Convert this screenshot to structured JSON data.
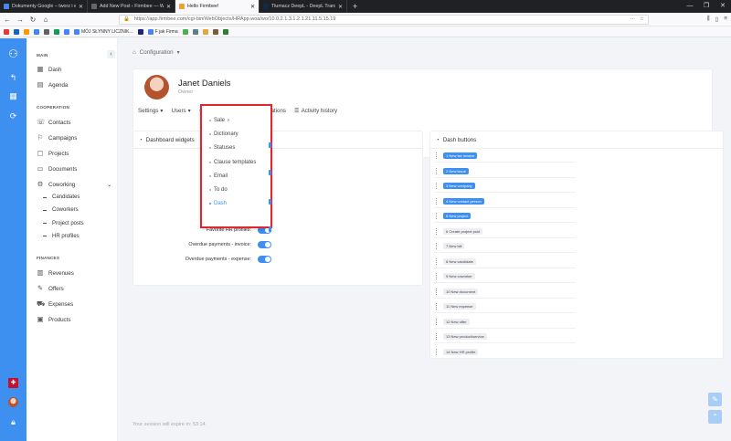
{
  "browser": {
    "tabs": [
      {
        "title": "Dokumenty Google – tworz i e",
        "active": false,
        "color": "#4a86e8"
      },
      {
        "title": "Add New Post ‹ Firmbee — WordPr",
        "active": false,
        "color": "#666666"
      },
      {
        "title": "Hello Firmbee!",
        "active": true,
        "color": "#e8a33d"
      },
      {
        "title": "Tłumacz DeepL - DeepL Transla",
        "active": false,
        "color": "#0f2b46"
      }
    ],
    "url": "https://app.firmbee.com/cgi-bin/WebObjects/HRApp.woa/wo/10.0.2.1.3.1.2.1.21.11.5.15.19",
    "bookmarks": [
      {
        "label": "",
        "color": "#e53935"
      },
      {
        "label": "",
        "color": "#1565c0"
      },
      {
        "label": "",
        "color": "#ff9800"
      },
      {
        "label": "",
        "color": "#4285f4"
      },
      {
        "label": "",
        "color": "#616161"
      },
      {
        "label": "",
        "color": "#0f9d58"
      },
      {
        "label": "",
        "color": "#4285f4"
      },
      {
        "label": "MÓJ SŁYNNY LICZNIK...",
        "color": "#4285f4"
      },
      {
        "label": "",
        "color": "#1a237e"
      },
      {
        "label": "F jak Firma",
        "color": "#4a86e8"
      },
      {
        "label": "",
        "color": "#4caf50"
      },
      {
        "label": "",
        "color": "#607d8b"
      },
      {
        "label": "",
        "color": "#e8a33d"
      },
      {
        "label": "",
        "color": "#7a5c3d"
      },
      {
        "label": "",
        "color": "#2e7d32"
      }
    ]
  },
  "sidebar": {
    "main_title": "MAIN",
    "main_items": [
      {
        "label": "Dash",
        "icon": "dashboard-icon",
        "glyph": "▦"
      },
      {
        "label": "Agenda",
        "icon": "calendar-icon",
        "glyph": "▤"
      }
    ],
    "coop_title": "COOPERATION",
    "coop_items": [
      {
        "label": "Contacts",
        "icon": "contacts-icon",
        "glyph": "☏"
      },
      {
        "label": "Campaigns",
        "icon": "campaign-icon",
        "glyph": "⚐"
      },
      {
        "label": "Projects",
        "icon": "projects-icon",
        "glyph": "▢"
      },
      {
        "label": "Documents",
        "icon": "documents-icon",
        "glyph": "▭"
      },
      {
        "label": "Coworking",
        "icon": "coworking-icon",
        "glyph": "⚙"
      }
    ],
    "coworking_sub": [
      "Candidates",
      "Coworkers",
      "Project posts",
      "HR profiles"
    ],
    "fin_title": "FINANCES",
    "fin_items": [
      {
        "label": "Revenues",
        "icon": "revenues-icon",
        "glyph": "▥"
      },
      {
        "label": "Offers",
        "icon": "offers-icon",
        "glyph": "✎"
      },
      {
        "label": "Expenses",
        "icon": "expenses-icon",
        "glyph": "⛟"
      },
      {
        "label": "Products",
        "icon": "products-icon",
        "glyph": "▣"
      }
    ]
  },
  "breadcrumb": {
    "label": "Configuration"
  },
  "profile": {
    "name": "Janet Daniels",
    "role": "Owner",
    "tabs": [
      {
        "label": "Settings",
        "active": false
      },
      {
        "label": "Users",
        "active": false
      },
      {
        "label": "Preferences",
        "active": true
      },
      {
        "label": "Integrations",
        "active": false
      },
      {
        "label": "Activity history",
        "active": false
      }
    ]
  },
  "preferences_menu": [
    {
      "label": "Sale",
      "active": false
    },
    {
      "label": "Dictionary",
      "active": false
    },
    {
      "label": "Statuses",
      "active": false
    },
    {
      "label": "Clause templates",
      "active": false
    },
    {
      "label": "Email",
      "active": false
    },
    {
      "label": "To do",
      "active": false
    },
    {
      "label": "Dash",
      "active": true
    }
  ],
  "widgets": {
    "title": "Dashboard widgets",
    "toggles": [
      {
        "label": "Favorite HR profiles:",
        "on": true
      },
      {
        "label": "Overdue payments - invoice:",
        "on": true
      },
      {
        "label": "Overdue payments - expense:",
        "on": true
      }
    ]
  },
  "dash_buttons": {
    "title": "Dash buttons",
    "items": [
      {
        "label": "1 New tax invoice",
        "active": true
      },
      {
        "label": "2 New issue",
        "active": true
      },
      {
        "label": "3 New company",
        "active": true
      },
      {
        "label": "4 New contact person",
        "active": true
      },
      {
        "label": "5 New project",
        "active": true
      },
      {
        "label": "6 Create project post",
        "active": false
      },
      {
        "label": "7 New bill",
        "active": false
      },
      {
        "label": "8 New candidate",
        "active": false
      },
      {
        "label": "9 New coworker",
        "active": false
      },
      {
        "label": "10 New document",
        "active": false
      },
      {
        "label": "11 New expense",
        "active": false
      },
      {
        "label": "12 New offer",
        "active": false
      },
      {
        "label": "13 New product/service",
        "active": false
      },
      {
        "label": "14 New HR profile",
        "active": false
      }
    ]
  },
  "session": "Your session will expire in: 53:14"
}
